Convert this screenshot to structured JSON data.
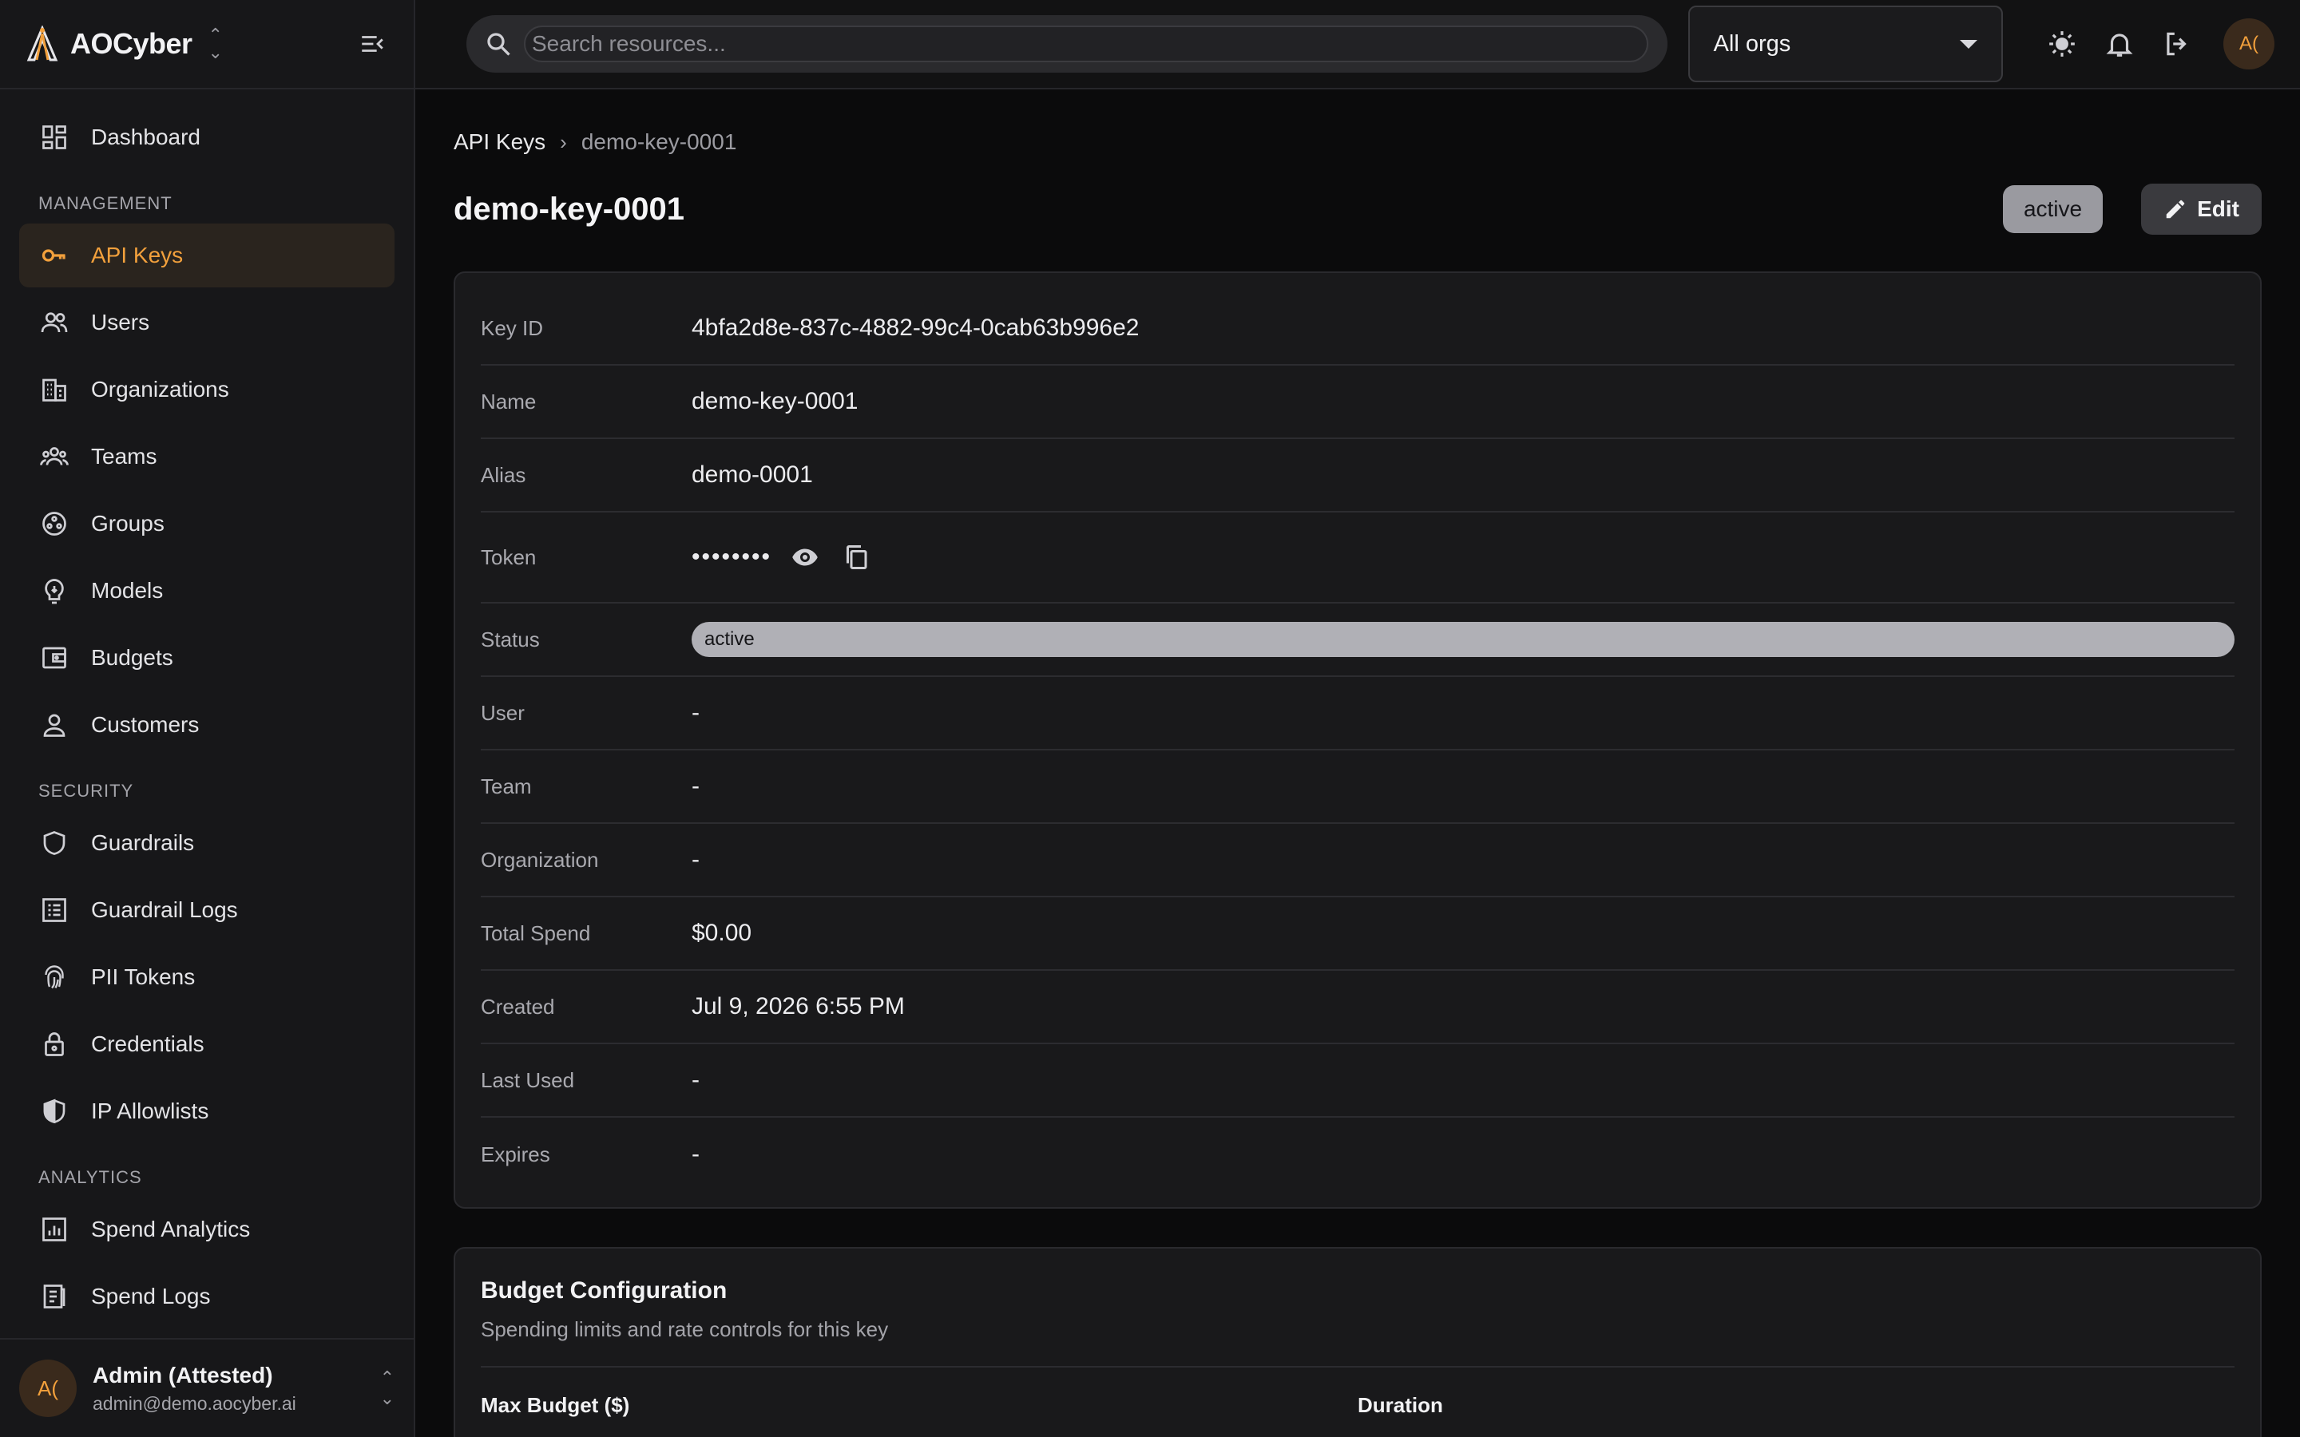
{
  "brand": {
    "name": "AOCyber"
  },
  "sidebar": {
    "top_items": [
      {
        "label": "Dashboard",
        "icon": "dashboard-icon"
      }
    ],
    "sections": [
      {
        "label": "MANAGEMENT",
        "items": [
          {
            "label": "API Keys",
            "icon": "key-icon",
            "active": true
          },
          {
            "label": "Users",
            "icon": "users-icon"
          },
          {
            "label": "Organizations",
            "icon": "building-icon"
          },
          {
            "label": "Teams",
            "icon": "teams-icon"
          },
          {
            "label": "Groups",
            "icon": "groups-icon"
          },
          {
            "label": "Models",
            "icon": "model-icon"
          },
          {
            "label": "Budgets",
            "icon": "wallet-icon"
          },
          {
            "label": "Customers",
            "icon": "customer-icon"
          }
        ]
      },
      {
        "label": "SECURITY",
        "items": [
          {
            "label": "Guardrails",
            "icon": "shield-icon"
          },
          {
            "label": "Guardrail Logs",
            "icon": "list-icon"
          },
          {
            "label": "PII Tokens",
            "icon": "fingerprint-icon"
          },
          {
            "label": "Credentials",
            "icon": "lock-icon"
          },
          {
            "label": "IP Allowlists",
            "icon": "shield-half-icon"
          }
        ]
      },
      {
        "label": "ANALYTICS",
        "items": [
          {
            "label": "Spend Analytics",
            "icon": "bar-chart-icon"
          },
          {
            "label": "Spend Logs",
            "icon": "receipt-icon"
          }
        ]
      }
    ],
    "user": {
      "initials": "A(",
      "name": "Admin (Attested)",
      "email": "admin@demo.aocyber.ai"
    }
  },
  "topbar": {
    "search_placeholder": "Search resources...",
    "org_select": "All orgs",
    "avatar_initials": "A("
  },
  "breadcrumb": {
    "parent": "API Keys",
    "current": "demo-key-0001"
  },
  "page": {
    "title": "demo-key-0001",
    "status": "active",
    "edit_label": "Edit"
  },
  "details": {
    "key_id": {
      "label": "Key ID",
      "value": "4bfa2d8e-837c-4882-99c4-0cab63b996e2"
    },
    "name": {
      "label": "Name",
      "value": "demo-key-0001"
    },
    "alias": {
      "label": "Alias",
      "value": "demo-0001"
    },
    "token": {
      "label": "Token",
      "value": "••••••••"
    },
    "status": {
      "label": "Status",
      "value": "active"
    },
    "user": {
      "label": "User",
      "value": "-"
    },
    "team": {
      "label": "Team",
      "value": "-"
    },
    "organization": {
      "label": "Organization",
      "value": "-"
    },
    "total_spend": {
      "label": "Total Spend",
      "value": "$0.00"
    },
    "created": {
      "label": "Created",
      "value": "Jul 9, 2026 6:55 PM"
    },
    "last_used": {
      "label": "Last Used",
      "value": "-"
    },
    "expires": {
      "label": "Expires",
      "value": "-"
    }
  },
  "budget": {
    "title": "Budget Configuration",
    "subtitle": "Spending limits and rate controls for this key",
    "col_max_budget": "Max Budget ($)",
    "col_duration": "Duration"
  },
  "colors": {
    "accent": "#f2a03c",
    "background": "#0b0b0c",
    "sidebar": "#171719"
  }
}
